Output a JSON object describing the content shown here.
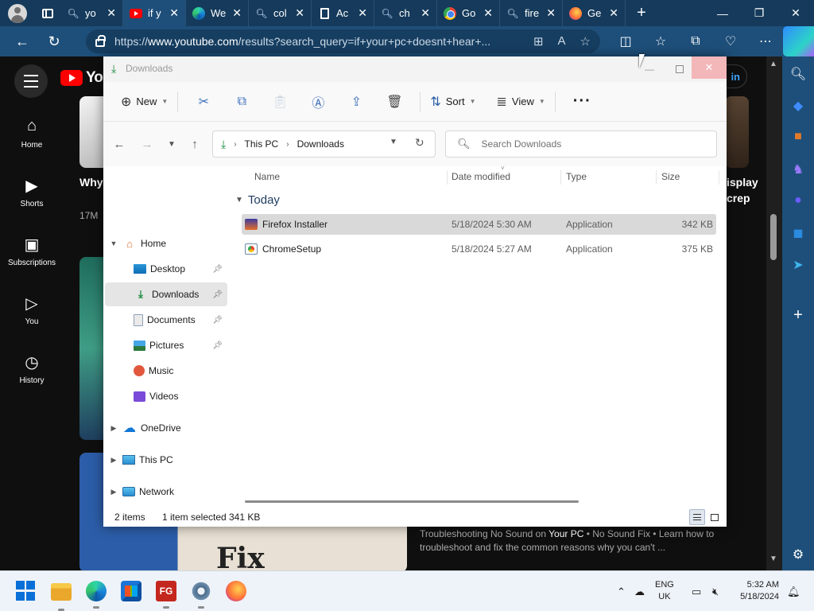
{
  "browser": {
    "tabs": [
      {
        "title": "yo",
        "icon": "search-icon",
        "active": false
      },
      {
        "title": "if y",
        "icon": "youtube-icon",
        "active": true
      },
      {
        "title": "We",
        "icon": "edge-icon",
        "active": false
      },
      {
        "title": "col",
        "icon": "search-icon",
        "active": false
      },
      {
        "title": "Ac",
        "icon": "document-icon",
        "active": false
      },
      {
        "title": "ch",
        "icon": "search-icon",
        "active": false
      },
      {
        "title": "Go",
        "icon": "chrome-icon",
        "active": false
      },
      {
        "title": "fire",
        "icon": "search-icon",
        "active": false
      },
      {
        "title": "Ge",
        "icon": "firefox-icon",
        "active": false
      }
    ],
    "url_prefix": "https://",
    "url_domain": "www.youtube.com",
    "url_rest": "/results?search_query=if+your+pc+doesnt+hear+..."
  },
  "youtube": {
    "rail": [
      {
        "label": "Home",
        "icon": "home-icon"
      },
      {
        "label": "Shorts",
        "icon": "shorts-icon"
      },
      {
        "label": "Subscriptions",
        "icon": "subscriptions-icon"
      },
      {
        "label": "You",
        "icon": "you-icon"
      },
      {
        "label": "History",
        "icon": "history-icon"
      }
    ],
    "logo_text": "You",
    "signin_label": "in",
    "video1_title_fragment": "Why",
    "video1_views_fragment": "17M",
    "right_title_line1": "isplay",
    "right_title_line2": "crep",
    "thumb_text": "Fix",
    "desc_pre": "Troubleshooting No Sound on ",
    "desc_bold": "Your PC",
    "desc_post": " • No Sound Fix • Learn how to troubleshoot and fix the common reasons why you can't ..."
  },
  "explorer": {
    "window_title": "Downloads",
    "toolbar": {
      "new_label": "New",
      "sort_label": "Sort",
      "view_label": "View"
    },
    "breadcrumb": [
      "This PC",
      "Downloads"
    ],
    "search_placeholder": "Search Downloads",
    "nav": {
      "home": "Home",
      "desktop": "Desktop",
      "downloads": "Downloads",
      "documents": "Documents",
      "pictures": "Pictures",
      "music": "Music",
      "videos": "Videos",
      "onedrive": "OneDrive",
      "thispc": "This PC",
      "network": "Network"
    },
    "columns": {
      "name": "Name",
      "date": "Date modified",
      "type": "Type",
      "size": "Size"
    },
    "group_label": "Today",
    "files": [
      {
        "name": "Firefox Installer",
        "date": "5/18/2024 5:30 AM",
        "type": "Application",
        "size": "342 KB",
        "selected": true
      },
      {
        "name": "ChromeSetup",
        "date": "5/18/2024 5:27 AM",
        "type": "Application",
        "size": "375 KB",
        "selected": false
      }
    ],
    "status": {
      "items": "2 items",
      "selected": "1 item selected",
      "size": "341 KB"
    }
  },
  "taskbar": {
    "lang_line1": "ENG",
    "lang_line2": "UK",
    "time": "5:32 AM",
    "date": "5/18/2024"
  }
}
